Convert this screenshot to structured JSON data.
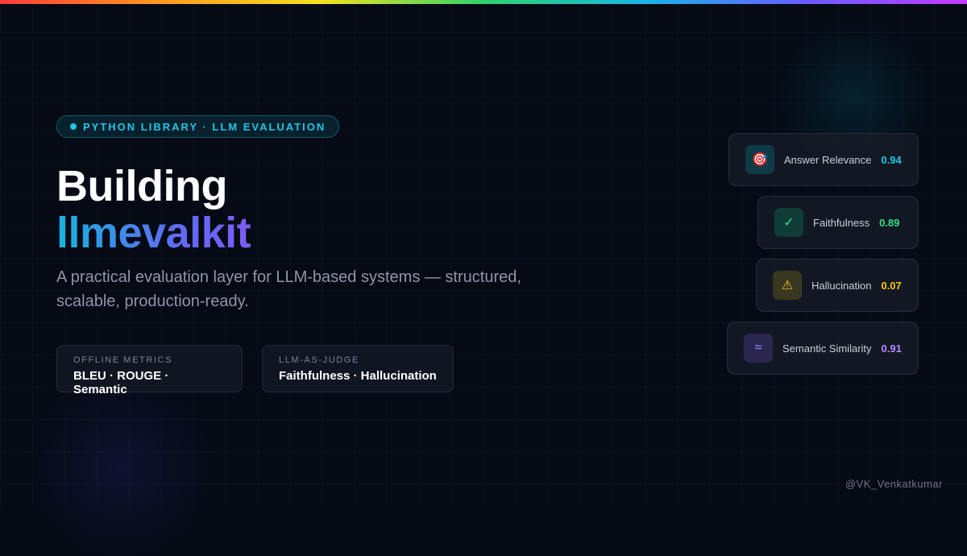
{
  "badge": {
    "text": "PYTHON LIBRARY · LLM EVALUATION",
    "color": "#22c7e3"
  },
  "title": {
    "line1": "Building",
    "line2": "llmevalkit"
  },
  "subtitle": "A practical evaluation layer for LLM-based systems — structured, scalable, production-ready.",
  "features": [
    {
      "label": "OFFLINE METRICS",
      "value": "BLEU · ROUGE · Semantic"
    },
    {
      "label": "LLM-AS-JUDGE",
      "value": "Faithfulness · Hallucination"
    }
  ],
  "metrics": [
    {
      "icon": "target-icon",
      "glyph": "🎯",
      "label": "Answer Relevance",
      "value": "0.94",
      "color": "#22c7e3",
      "icon_bg": "#0f3a48"
    },
    {
      "icon": "check-icon",
      "glyph": "✓",
      "label": "Faithfulness",
      "value": "0.89",
      "color": "#2ee08a",
      "icon_bg": "#0f3d35"
    },
    {
      "icon": "warning-icon",
      "glyph": "⚠",
      "label": "Hallucination",
      "value": "0.07",
      "color": "#f5c518",
      "icon_bg": "#3a3720"
    },
    {
      "icon": "approx-icon",
      "glyph": "≈",
      "label": "Semantic Similarity",
      "value": "0.91",
      "color": "#b18cff",
      "icon_bg": "#2a2650"
    }
  ],
  "handle": "@VK_Venkatkumar"
}
